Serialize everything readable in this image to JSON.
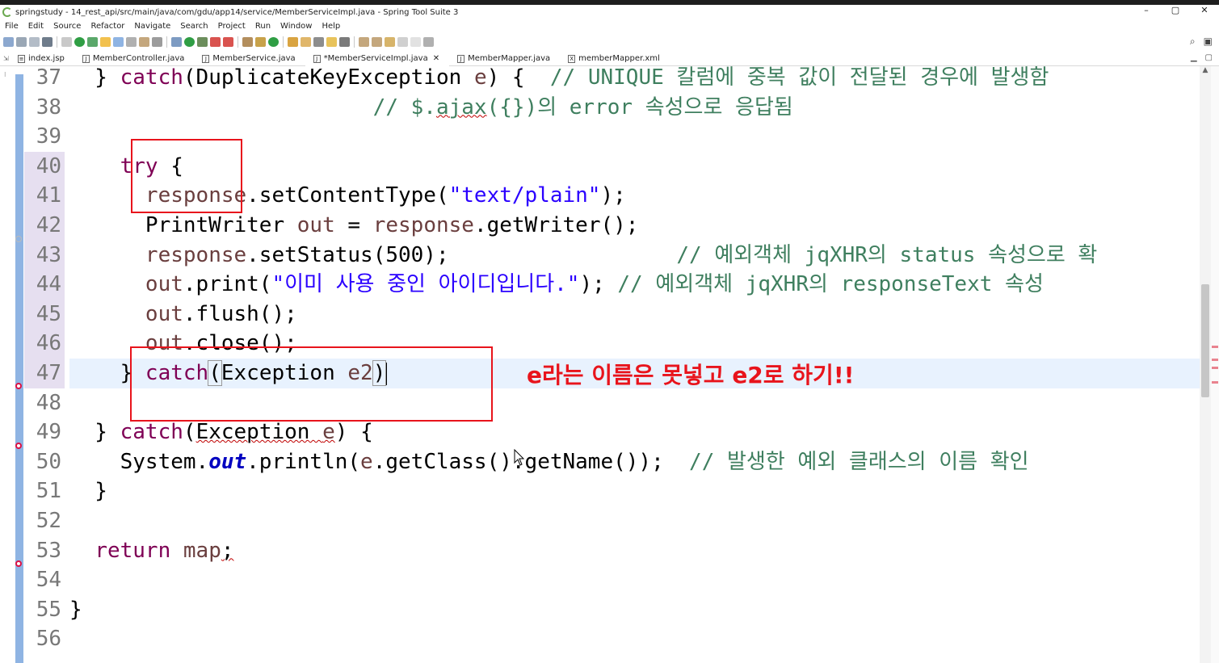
{
  "window": {
    "title": "springstudy - 14_rest_api/src/main/java/com/gdu/app14/service/MemberServiceImpl.java - Spring Tool Suite 3",
    "controls": [
      "–",
      "▢",
      "✕"
    ]
  },
  "menu": [
    "File",
    "Edit",
    "Source",
    "Refactor",
    "Navigate",
    "Search",
    "Project",
    "Run",
    "Window",
    "Help"
  ],
  "tabs": [
    {
      "label": "index.jsp",
      "icon": "jsp-file-icon",
      "active": false
    },
    {
      "label": "MemberController.java",
      "icon": "java-file-icon",
      "active": false
    },
    {
      "label": "MemberService.java",
      "icon": "java-file-icon",
      "active": false
    },
    {
      "label": "*MemberServiceImpl.java",
      "icon": "java-file-icon",
      "active": true
    },
    {
      "label": "MemberMapper.java",
      "icon": "java-file-icon",
      "active": false
    },
    {
      "label": "memberMapper.xml",
      "icon": "xml-file-icon",
      "active": false
    }
  ],
  "editor": {
    "lines": [
      {
        "n": "37",
        "text": "  } catch(DuplicateKeyException e) {  // UNIQUE 칼럼에 중복 값이 전달된 경우에 발생함"
      },
      {
        "n": "38",
        "text": "                                     // $.ajax({})의 error 속성으로 응답됨"
      },
      {
        "n": "39",
        "text": ""
      },
      {
        "n": "40",
        "text": "    try {"
      },
      {
        "n": "41",
        "text": "      response.setContentType(\"text/plain\");"
      },
      {
        "n": "42",
        "text": "      PrintWriter out = response.getWriter();"
      },
      {
        "n": "43",
        "text": "      response.setStatus(500);                  // 예외객체 jqXHR의 status 속성으로 확"
      },
      {
        "n": "44",
        "text": "      out.print(\"이미 사용 중인 아이디입니다.\"); // 예외객체 jqXHR의 responseText 속성"
      },
      {
        "n": "45",
        "text": "      out.flush();"
      },
      {
        "n": "46",
        "text": "      out.close();"
      },
      {
        "n": "47",
        "text": "    } catch(Exception e2)"
      },
      {
        "n": "48",
        "text": ""
      },
      {
        "n": "49",
        "text": "  } catch(Exception e) {"
      },
      {
        "n": "50",
        "text": "    System.out.println(e.getClass().getName());  // 발생한 예외 클래스의 이름 확인"
      },
      {
        "n": "51",
        "text": "  }"
      },
      {
        "n": "52",
        "text": ""
      },
      {
        "n": "53",
        "text": "  return map;"
      },
      {
        "n": "54",
        "text": ""
      },
      {
        "n": "55",
        "text": "}"
      },
      {
        "n": "56",
        "text": ""
      }
    ]
  },
  "annotation": {
    "text": "e라는 이름은 못넣고 e2로 하기!!",
    "color": "#e8141c"
  },
  "colors": {
    "keyword": "#7f0055",
    "string": "#2a00ff",
    "comment": "#3f7f5f",
    "field": "#0000c0",
    "variable": "#6a3e3e",
    "current_line": "#e8f2fe",
    "annotation_red": "#e8141c"
  }
}
